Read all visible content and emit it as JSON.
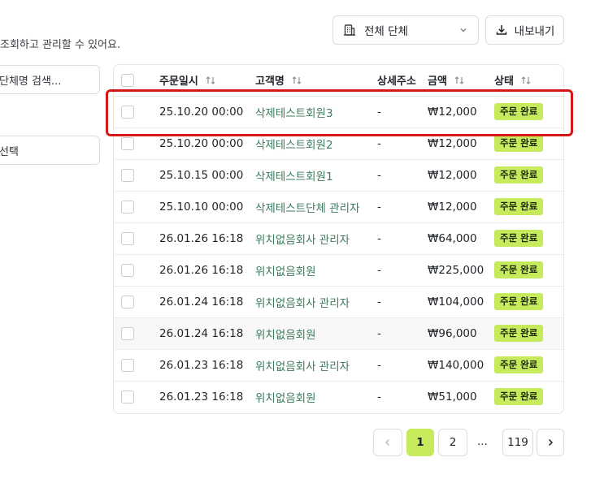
{
  "header": {
    "subtitle": "조회하고 관리할 수 있어요.",
    "group_filter": "전체 단체",
    "export_label": "내보내기"
  },
  "sidebar": {
    "search_placeholder": "단체명 검색...",
    "select_label": "선택"
  },
  "table": {
    "columns": {
      "date": "주문일시",
      "customer": "고객명",
      "address": "상세주소",
      "amount": "금액",
      "status": "상태"
    },
    "rows": [
      {
        "date": "25.10.20 00:00",
        "customer": "삭제테스트회원3",
        "address": "-",
        "amount": "₩12,000",
        "status": "주문 완료"
      },
      {
        "date": "25.10.20 00:00",
        "customer": "삭제테스트회원2",
        "address": "-",
        "amount": "₩12,000",
        "status": "주문 완료"
      },
      {
        "date": "25.10.15 00:00",
        "customer": "삭제테스트회원1",
        "address": "-",
        "amount": "₩12,000",
        "status": "주문 완료"
      },
      {
        "date": "25.10.10 00:00",
        "customer": "삭제테스트단체 관리자",
        "address": "-",
        "amount": "₩12,000",
        "status": "주문 완료"
      },
      {
        "date": "26.01.26 16:18",
        "customer": "위치없음회사 관리자",
        "address": "-",
        "amount": "₩64,000",
        "status": "주문 완료"
      },
      {
        "date": "26.01.26 16:18",
        "customer": "위치없음회원",
        "address": "-",
        "amount": "₩225,000",
        "status": "주문 완료"
      },
      {
        "date": "26.01.24 16:18",
        "customer": "위치없음회사 관리자",
        "address": "-",
        "amount": "₩104,000",
        "status": "주문 완료"
      },
      {
        "date": "26.01.24 16:18",
        "customer": "위치없음회원",
        "address": "-",
        "amount": "₩96,000",
        "status": "주문 완료"
      },
      {
        "date": "26.01.23 16:18",
        "customer": "위치없음회사 관리자",
        "address": "-",
        "amount": "₩140,000",
        "status": "주문 완료"
      },
      {
        "date": "26.01.23 16:18",
        "customer": "위치없음회원",
        "address": "-",
        "amount": "₩51,000",
        "status": "주문 완료"
      }
    ]
  },
  "pagination": {
    "current": "1",
    "page2": "2",
    "ellipsis": "...",
    "last": "119"
  },
  "colors": {
    "accent": "#c5ea5b",
    "link": "#3c7a5c",
    "highlight": "#d41717"
  },
  "icons": {
    "group_filter": "building-icon",
    "dropdown": "chevron-down-icon",
    "export": "download-icon",
    "sort": "sort-arrows-icon",
    "prev": "chevron-left-icon",
    "next": "chevron-right-icon"
  }
}
